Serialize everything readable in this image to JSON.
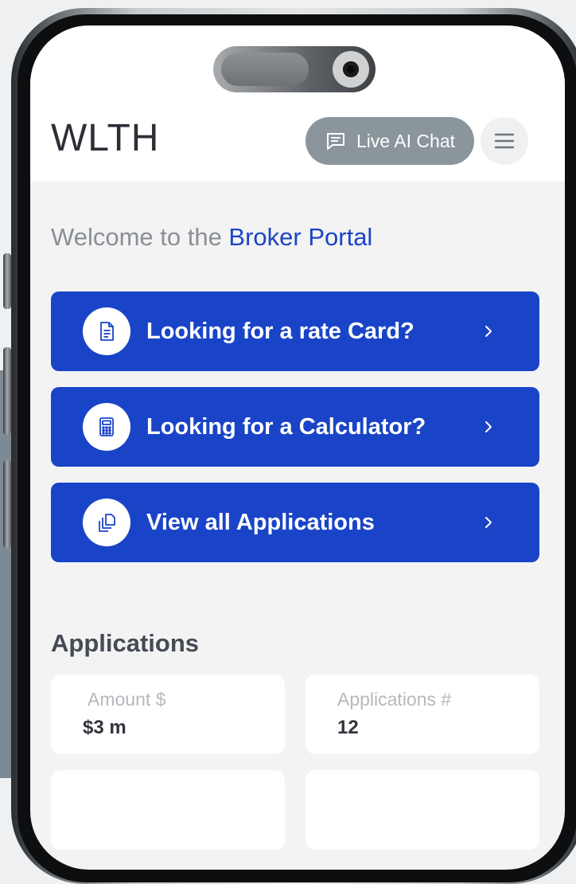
{
  "header": {
    "logo": "WLTH",
    "live_chat_label": "Live AI Chat",
    "menu_icon": "hamburger-menu-icon"
  },
  "welcome": {
    "prefix": "Welcome to the ",
    "highlight": "Broker Portal"
  },
  "actions": [
    {
      "label": "Looking for a rate Card?",
      "icon": "document-icon"
    },
    {
      "label": "Looking for a Calculator?",
      "icon": "calculator-icon"
    },
    {
      "label": "View all Applications",
      "icon": "stacked-files-icon"
    }
  ],
  "applications": {
    "title": "Applications",
    "stats": [
      {
        "label": "Amount $",
        "value": "$3 m"
      },
      {
        "label": "Applications #",
        "value": "12"
      }
    ]
  },
  "colors": {
    "brand_blue": "#1a44c7",
    "chat_button": "#8a959c",
    "screen_bg": "#f3f3f4"
  }
}
